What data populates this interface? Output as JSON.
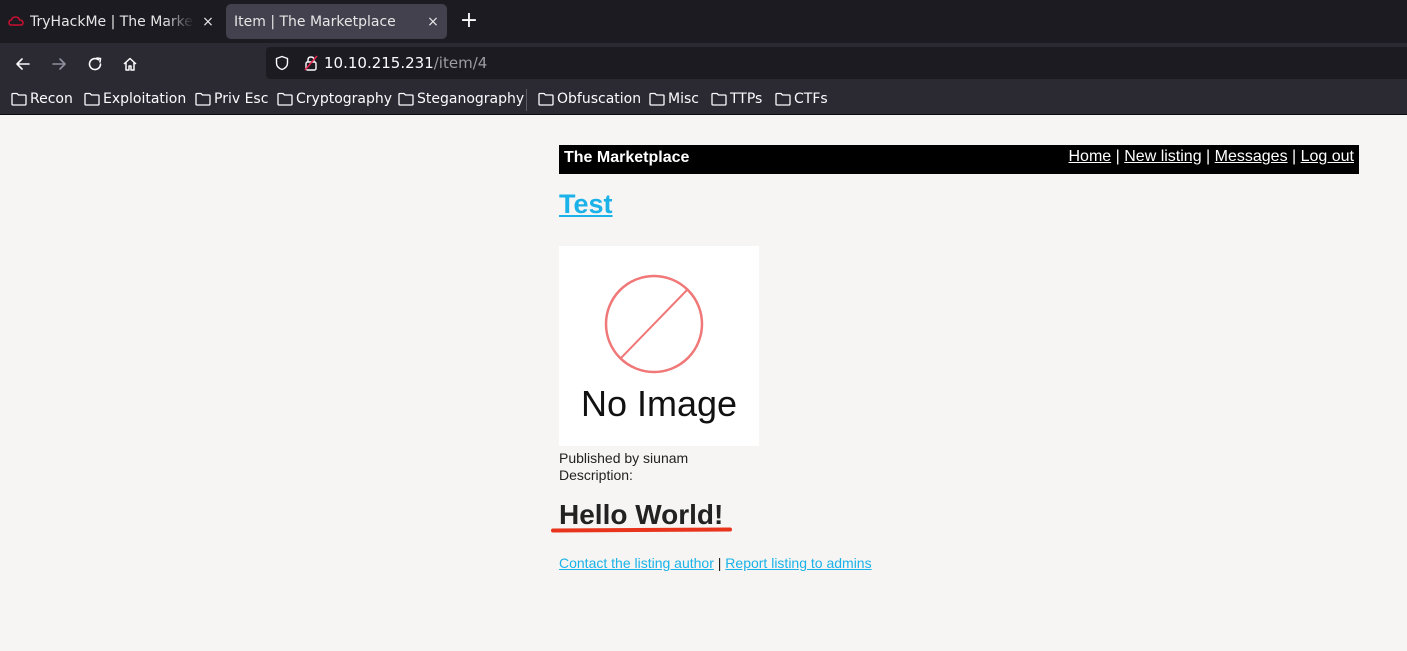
{
  "browser": {
    "tabs": [
      {
        "title": "TryHackMe | The Marketplace",
        "close": "×"
      },
      {
        "title": "Item | The Marketplace",
        "close": "×"
      }
    ],
    "new_tab": "+",
    "url": {
      "host": "10.10.215.231",
      "path": "/item/4"
    },
    "bookmarks": [
      "Recon",
      "Exploitation",
      "Priv Esc",
      "Cryptography",
      "Steganography",
      "Obfuscation",
      "Misc",
      "TTPs",
      "CTFs"
    ],
    "icons": {
      "back": "back-arrow-icon",
      "forward": "forward-arrow-icon",
      "reload": "reload-icon",
      "home": "home-icon",
      "shield": "shield-icon",
      "lock": "insecure-lock-icon",
      "folder": "folder-icon"
    }
  },
  "site": {
    "brand": "The Marketplace",
    "nav": {
      "home": "Home",
      "new_listing": "New listing",
      "messages": "Messages",
      "logout": "Log out",
      "sep": " | "
    }
  },
  "listing": {
    "title": "Test",
    "image_text": "No Image",
    "published_by": "Published by siunam",
    "description_label": "Description:",
    "description": "Hello World!",
    "contact_link": "Contact the listing author",
    "report_link": "Report listing to admins",
    "sep": " | "
  },
  "colors": {
    "link": "#1ab2e8",
    "annotation_underline": "#e8341c",
    "header_bg": "#000000",
    "page_bg": "#f6f5f3",
    "no_image_symbol": "#f07878"
  }
}
